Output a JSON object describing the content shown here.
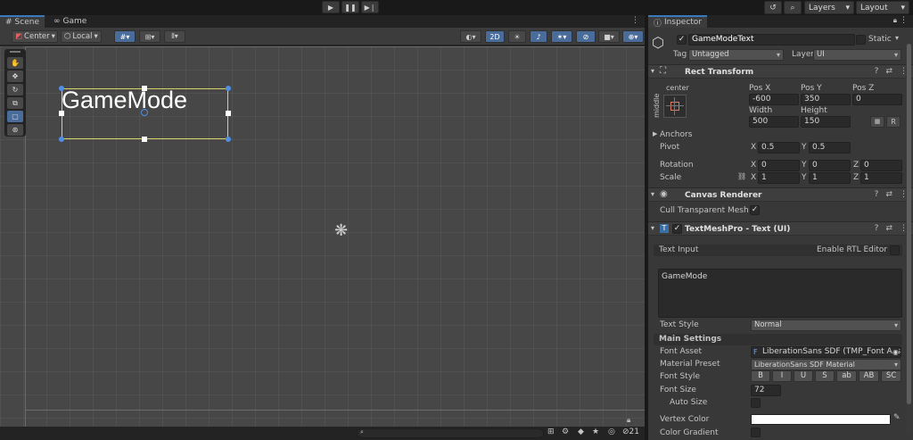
{
  "toolbar": {
    "play_icon": "play-icon",
    "pause_icon": "pause-icon",
    "step_icon": "step-icon",
    "layers_label": "Layers",
    "layout_label": "Layout"
  },
  "scene": {
    "tabs": [
      {
        "label": "Scene"
      },
      {
        "label": "Game"
      }
    ],
    "pivot_label": "Center",
    "space_label": "Local",
    "mode_2d_label": "2D",
    "object_text": "GameMode",
    "status_count": "21"
  },
  "inspector": {
    "tab_label": "Inspector",
    "object_name": "GameModeText",
    "static_label": "Static",
    "tag_label": "Tag",
    "tag_value": "Untagged",
    "layer_label": "Layer",
    "layer_value": "UI",
    "rect_transform": {
      "title": "Rect Transform",
      "anchor_preset_h": "center",
      "anchor_preset_v": "middle",
      "pos_x_label": "Pos X",
      "pos_x": "-600",
      "pos_y_label": "Pos Y",
      "pos_y": "350",
      "pos_z_label": "Pos Z",
      "pos_z": "0",
      "width_label": "Width",
      "width": "500",
      "height_label": "Height",
      "height": "150",
      "raw_label": "R",
      "anchors_label": "Anchors",
      "pivot_label": "Pivot",
      "pivot_x": "0.5",
      "pivot_y": "0.5",
      "rotation_label": "Rotation",
      "rot_x": "0",
      "rot_y": "0",
      "rot_z": "0",
      "scale_label": "Scale",
      "scale_x": "1",
      "scale_y": "1",
      "scale_z": "1",
      "x": "X",
      "y": "Y",
      "z": "Z"
    },
    "canvas_renderer": {
      "title": "Canvas Renderer",
      "cull_label": "Cull Transparent Mesh"
    },
    "tmp": {
      "title": "TextMeshPro - Text (UI)",
      "text_input_label": "Text Input",
      "rtl_label": "Enable RTL Editor",
      "text_value": "GameMode",
      "text_style_label": "Text Style",
      "text_style_value": "Normal",
      "main_settings_label": "Main Settings",
      "font_asset_label": "Font Asset",
      "font_asset_value": "LiberationSans SDF (TMP_Font Asset)",
      "material_preset_label": "Material Preset",
      "material_preset_value": "LiberationSans SDF Material",
      "font_style_label": "Font Style",
      "font_style_buttons": [
        "B",
        "I",
        "U",
        "S",
        "ab",
        "AB",
        "SC"
      ],
      "font_size_label": "Font Size",
      "font_size_value": "72",
      "auto_size_label": "Auto Size",
      "vertex_color_label": "Vertex Color",
      "color_gradient_label": "Color Gradient"
    }
  },
  "colors": {
    "accent": "#3a79bb",
    "selection_rect": "#d7d36a",
    "handle_blue": "#4f8fe6"
  }
}
